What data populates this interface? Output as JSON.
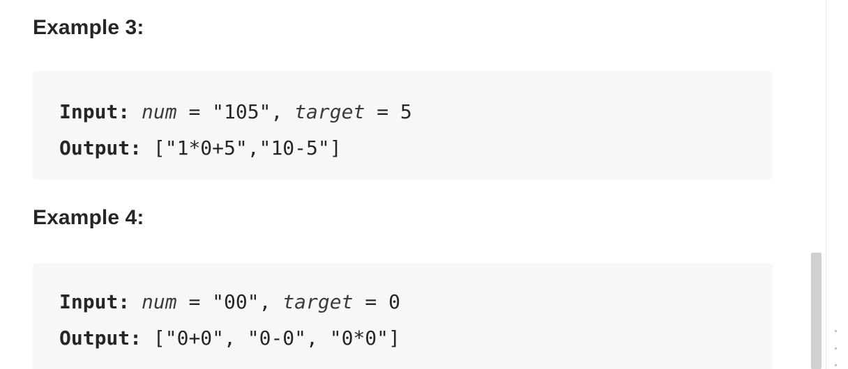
{
  "examples": [
    {
      "title": "Example 3:",
      "input": {
        "label": "Input:",
        "param1_name": "num",
        "param1_value": "\"105\"",
        "param2_name": "target",
        "param2_value": "5"
      },
      "output": {
        "label": "Output:",
        "value": "[\"1*0+5\",\"10-5\"]"
      }
    },
    {
      "title": "Example 4:",
      "input": {
        "label": "Input:",
        "param1_name": "num",
        "param1_value": "\"00\"",
        "param2_name": "target",
        "param2_value": "0"
      },
      "output": {
        "label": "Output:",
        "value": "[\"0+0\", \"0-0\", \"0*0\"]"
      }
    }
  ],
  "syntax": {
    "equals": " = ",
    "separator": ", "
  },
  "colors": {
    "code_background": "#f7f7f8",
    "text": "#262626",
    "scrollbar_thumb": "#d0d0d0"
  }
}
